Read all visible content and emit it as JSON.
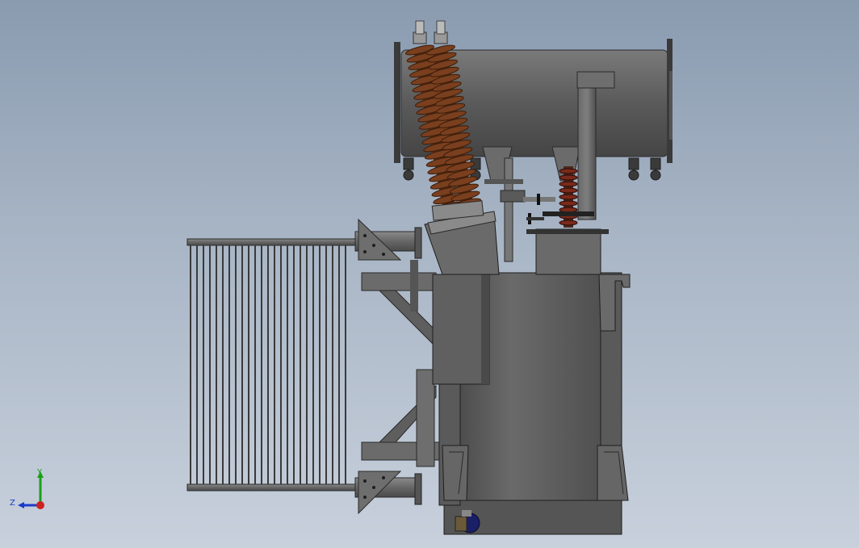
{
  "viewport": {
    "background_top": "#8a9bb0",
    "background_bottom": "#c8d0dc"
  },
  "model": {
    "body_color": "#5c5c5c",
    "body_shade": "#4a4a4a",
    "conservator_color": "#5a5a5a",
    "radiator_color": "#3a3a3a",
    "bushing_color": "#7a3f1e",
    "lv_bushing_color": "#7a2a1a",
    "edge_color": "#222222"
  },
  "triad": {
    "y_label": "Y",
    "z_label": "Z",
    "y_color": "#19a019",
    "z_color": "#1a3ccc",
    "x_color": "#cc2222"
  }
}
